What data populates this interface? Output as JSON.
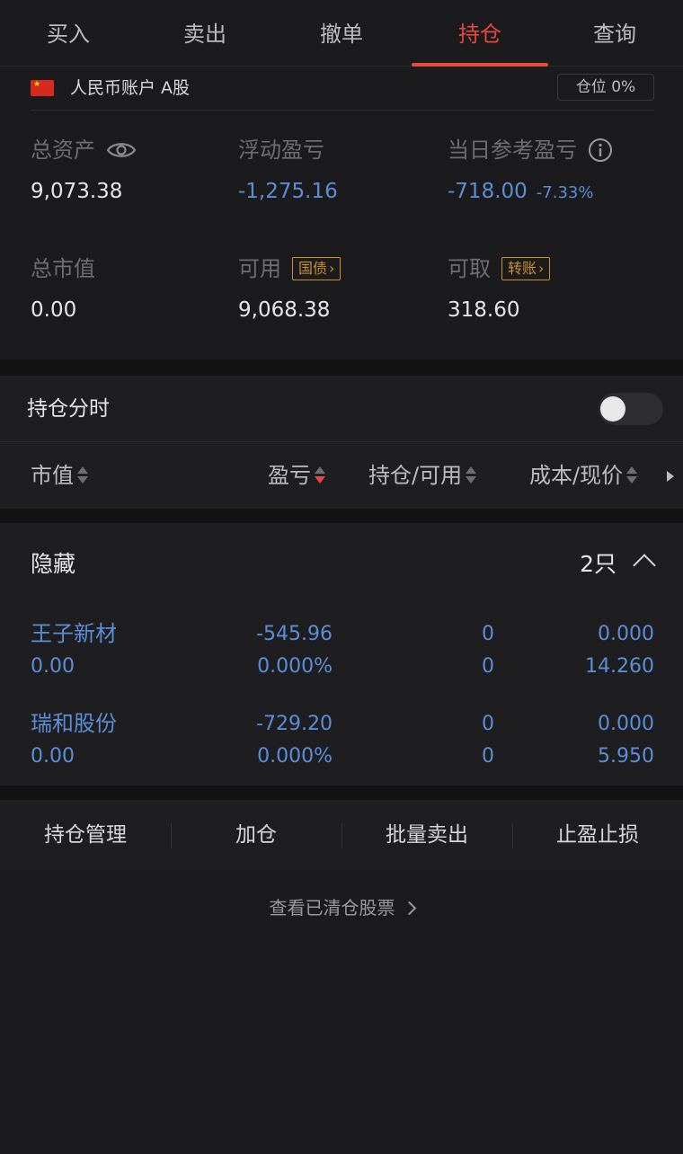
{
  "tabs": [
    {
      "label": "买入"
    },
    {
      "label": "卖出"
    },
    {
      "label": "撤单"
    },
    {
      "label": "持仓",
      "active": true
    },
    {
      "label": "查询"
    }
  ],
  "account": {
    "name": "人民币账户 A股",
    "position_badge": "仓位 0%"
  },
  "summary": {
    "total_assets": {
      "label": "总资产",
      "value": "9,073.38"
    },
    "floating_pnl": {
      "label": "浮动盈亏",
      "value": "-1,275.16"
    },
    "daily_pnl": {
      "label": "当日参考盈亏",
      "value": "-718.00",
      "pct": "-7.33%"
    },
    "market_value": {
      "label": "总市值",
      "value": "0.00"
    },
    "available": {
      "label": "可用",
      "tag": "国债",
      "value": "9,068.38"
    },
    "withdrawable": {
      "label": "可取",
      "tag": "转账",
      "value": "318.60"
    }
  },
  "fenshi": {
    "label": "持仓分时",
    "toggle_on": false
  },
  "columns": {
    "market_value": "市值",
    "pnl": "盈亏",
    "holding": "持仓/可用",
    "cost": "成本/现价"
  },
  "holdings": {
    "title": "隐藏",
    "count": "2只",
    "stocks": [
      {
        "name": "王子新材",
        "market_value": "0.00",
        "pnl": "-545.96",
        "pnl_pct": "0.000%",
        "holding": "0",
        "available": "0",
        "cost": "0.000",
        "price": "14.260"
      },
      {
        "name": "瑞和股份",
        "market_value": "0.00",
        "pnl": "-729.20",
        "pnl_pct": "0.000%",
        "holding": "0",
        "available": "0",
        "cost": "0.000",
        "price": "5.950"
      }
    ]
  },
  "actions": [
    "持仓管理",
    "加仓",
    "批量卖出",
    "止盈止损"
  ],
  "cleared_link": "查看已清仓股票",
  "colors": {
    "accent": "#e8473f",
    "negative": "#5b8ed6",
    "tag": "#c9902a",
    "background": "#1b1b1d"
  }
}
